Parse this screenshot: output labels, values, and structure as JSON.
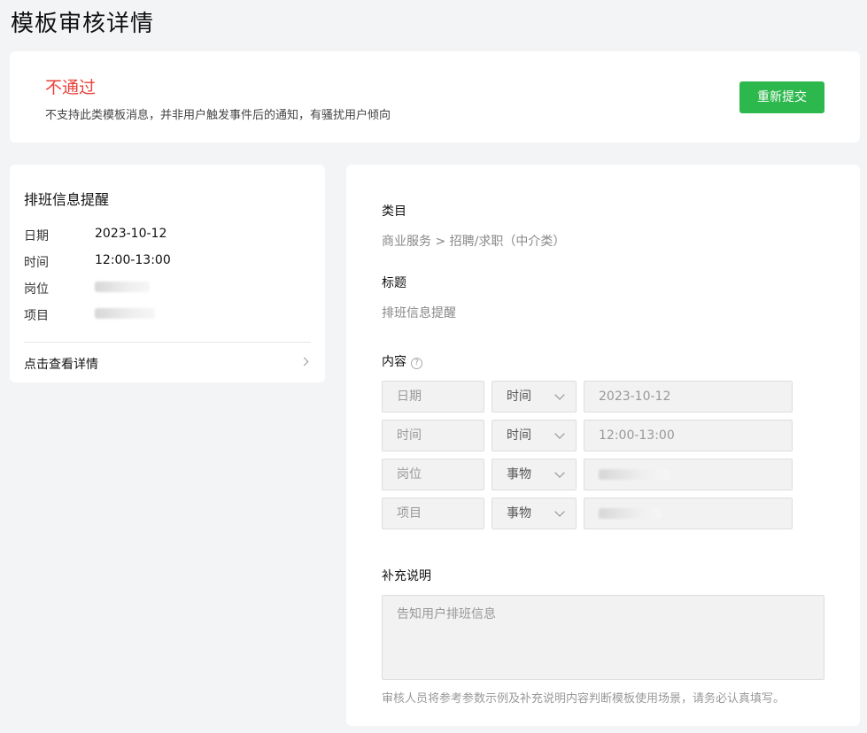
{
  "page_title": "模板审核详情",
  "status": {
    "title": "不通过",
    "reason": "不支持此类模板消息，并非用户触发事件后的通知，有骚扰用户倾向",
    "resubmit_label": "重新提交",
    "title_color": "#e8423b",
    "button_color": "#2db84d"
  },
  "preview": {
    "title": "排班信息提醒",
    "rows": [
      {
        "key": "日期",
        "value": "2023-10-12"
      },
      {
        "key": "时间",
        "value": "12:00-13:00"
      },
      {
        "key": "岗位",
        "value": ""
      },
      {
        "key": "项目",
        "value": ""
      }
    ],
    "link_label": "点击查看详情",
    "link_icon": "chevron-right-icon"
  },
  "detail": {
    "category_label": "类目",
    "category_value": "商业服务 > 招聘/求职（中介类）",
    "title_label": "标题",
    "title_value": "排班信息提醒",
    "content_label": "内容",
    "content_help_icon": "question-circle-icon",
    "params": [
      {
        "name": "日期",
        "type": "时间",
        "example": "2023-10-12"
      },
      {
        "name": "时间",
        "type": "时间",
        "example": "12:00-13:00"
      },
      {
        "name": "岗位",
        "type": "事物",
        "example": ""
      },
      {
        "name": "项目",
        "type": "事物",
        "example": ""
      }
    ],
    "supplement_label": "补充说明",
    "supplement_placeholder": "告知用户排班信息",
    "note": "审核人员将参考参数示例及补充说明内容判断模板使用场景，请务必认真填写。"
  }
}
